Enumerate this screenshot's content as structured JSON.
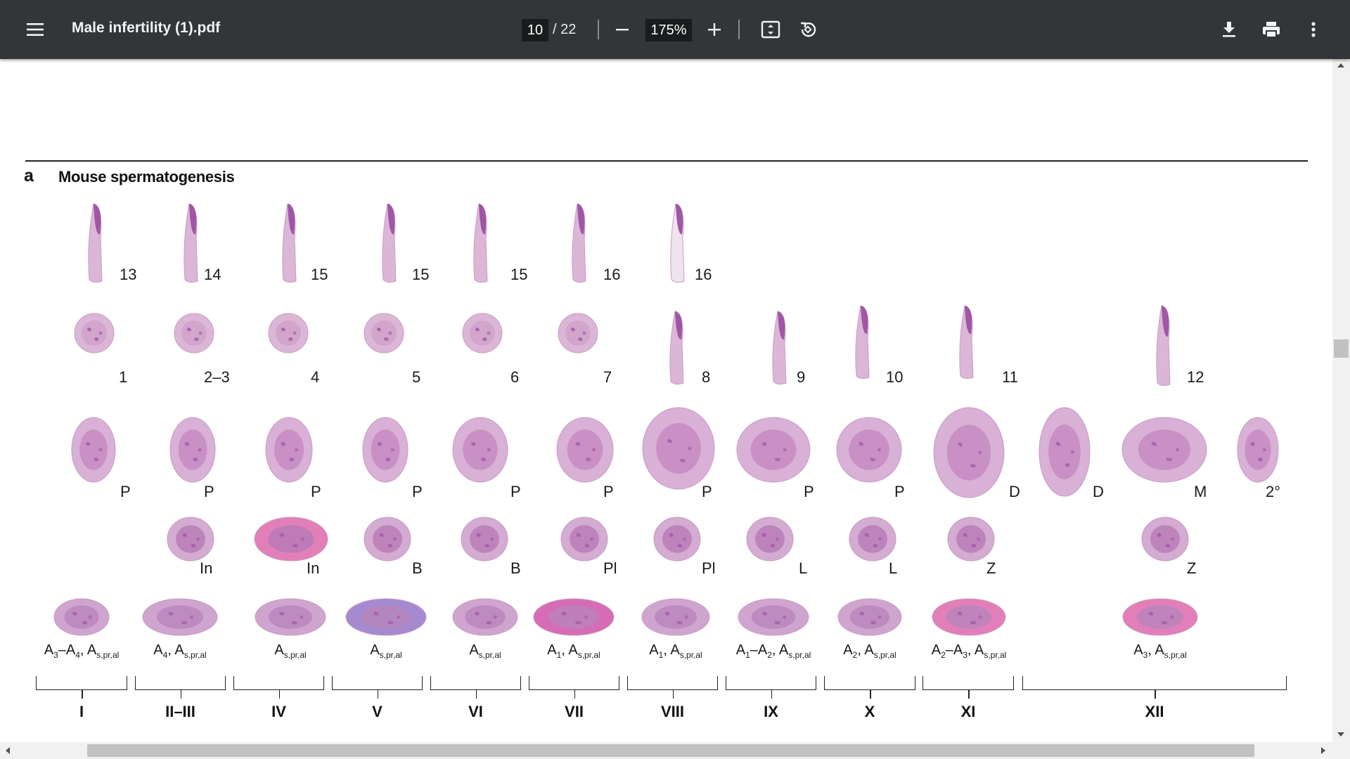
{
  "toolbar": {
    "title": "Male infertility (1).pdf",
    "current_page": "10",
    "page_total": "/ 22",
    "zoom": "175%",
    "icons": [
      "menu-icon",
      "zoom-out-icon",
      "zoom-in-icon",
      "fit-page-icon",
      "rotate-icon",
      "download-icon",
      "print-icon",
      "more-vert-icon"
    ]
  },
  "figure": {
    "panel_letter": "a",
    "panel_title": "Mouse spermatogenesis",
    "row_spermatids_late": [
      "13",
      "14",
      "15",
      "15",
      "15",
      "16",
      "16"
    ],
    "row_spermatids_early": [
      "1",
      "2–3",
      "4",
      "5",
      "6",
      "7",
      "8",
      "9",
      "10",
      "11",
      "12"
    ],
    "row_spermatocytes": [
      "P",
      "P",
      "P",
      "P",
      "P",
      "P",
      "P",
      "P",
      "P",
      "D",
      "D",
      "M",
      "2°"
    ],
    "row_early_spermatocytes": [
      "In",
      "In",
      "B",
      "B",
      "Pl",
      "Pl",
      "L",
      "L",
      "Z",
      "Z"
    ],
    "row_spermatogonia": [
      {
        "base": "A",
        "sub1": "3",
        "mid": "–A",
        "sub2": "4",
        "tail": ", A",
        "sub3": "s,pr,al"
      },
      {
        "base": "A",
        "sub1": "4",
        "mid": "",
        "sub2": "",
        "tail": ", A",
        "sub3": "s,pr,al"
      },
      {
        "base": "A",
        "sub1": "s,pr,al",
        "mid": "",
        "sub2": "",
        "tail": "",
        "sub3": ""
      },
      {
        "base": "A",
        "sub1": "s,pr,al",
        "mid": "",
        "sub2": "",
        "tail": "",
        "sub3": ""
      },
      {
        "base": "A",
        "sub1": "s,pr,al",
        "mid": "",
        "sub2": "",
        "tail": "",
        "sub3": ""
      },
      {
        "base": "A",
        "sub1": "1",
        "mid": "",
        "sub2": "",
        "tail": ", A",
        "sub3": "s,pr,al"
      },
      {
        "base": "A",
        "sub1": "1",
        "mid": "",
        "sub2": "",
        "tail": ", A",
        "sub3": "s,pr,al"
      },
      {
        "base": "A",
        "sub1": "1",
        "mid": "–A",
        "sub2": "2",
        "tail": ", A",
        "sub3": "s,pr,al"
      },
      {
        "base": "A",
        "sub1": "2",
        "mid": "",
        "sub2": "",
        "tail": ", A",
        "sub3": "s,pr,al"
      },
      {
        "base": "A",
        "sub1": "2",
        "mid": "–A",
        "sub2": "3",
        "tail": ", A",
        "sub3": "s,pr,al"
      },
      {
        "base": "A",
        "sub1": "3",
        "mid": "",
        "sub2": "",
        "tail": ", A",
        "sub3": "s,pr,al"
      }
    ],
    "stages": [
      "I",
      "II–III",
      "IV",
      "V",
      "VI",
      "VII",
      "VIII",
      "IX",
      "X",
      "XI",
      "XII"
    ]
  },
  "colors": {
    "toolbar_bg": "#323639",
    "stain_light": "#dcb6d6",
    "stain_dark": "#a056a6",
    "stain_pink": "#e27fb8"
  }
}
